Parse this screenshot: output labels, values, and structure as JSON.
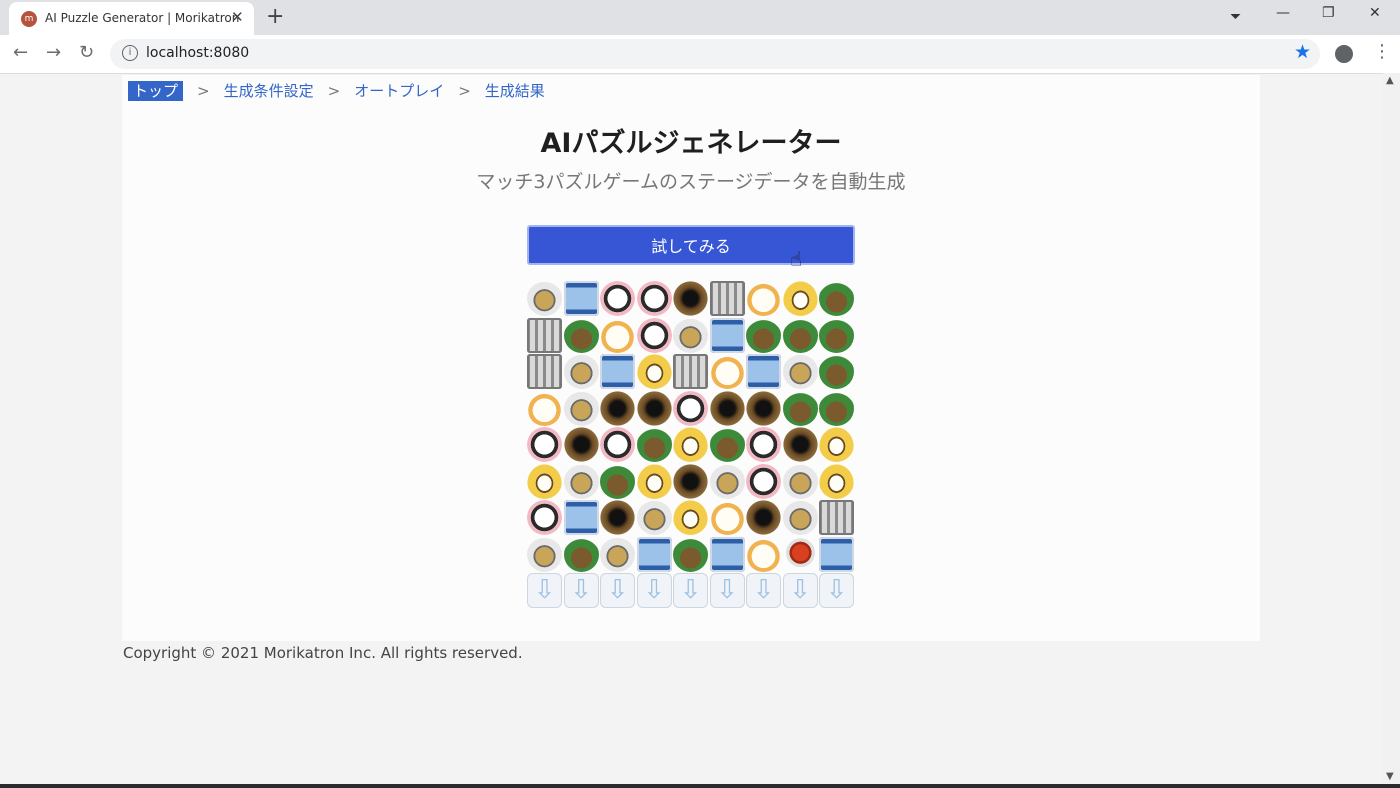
{
  "browser": {
    "tab_title": "AI Puzzle Generator | Morikatron",
    "url": "localhost:8080",
    "icons": [
      "back-arrow-icon",
      "forward-arrow-icon",
      "reload-icon",
      "info-icon",
      "bookmark-star-icon",
      "profile-icon",
      "menu-kebab-icon"
    ]
  },
  "breadcrumb": {
    "items": [
      {
        "label": "トップ",
        "active": true
      },
      {
        "label": "生成条件設定",
        "active": false
      },
      {
        "label": "オートプレイ",
        "active": false
      },
      {
        "label": "生成結果",
        "active": false
      }
    ],
    "separator": ">"
  },
  "header": {
    "title": "AIパズルジェネレーター",
    "subtitle": "マッチ3パズルゲームのステージデータを自動生成"
  },
  "cta": {
    "label": "試してみる"
  },
  "board": {
    "columns": 9,
    "rows": [
      [
        "giraffe",
        "jar",
        "cow",
        "cow",
        "hole",
        "cage",
        "chick",
        "penguin",
        "turtle"
      ],
      [
        "cage",
        "turtle",
        "chick",
        "cow",
        "giraffe",
        "jar",
        "turtle",
        "turtle",
        "turtle"
      ],
      [
        "cage",
        "giraffe",
        "jar",
        "penguin",
        "cage",
        "chick",
        "jar",
        "giraffe",
        "turtle"
      ],
      [
        "chick",
        "giraffe",
        "hole",
        "hole",
        "cow",
        "hole",
        "hole",
        "turtle",
        "turtle"
      ],
      [
        "cow",
        "hole",
        "cow",
        "turtle",
        "penguin",
        "turtle",
        "cow",
        "hole",
        "penguin"
      ],
      [
        "penguin",
        "giraffe",
        "turtle",
        "penguin",
        "hole",
        "giraffe",
        "cow",
        "giraffe",
        "penguin"
      ],
      [
        "cow",
        "jar",
        "hole",
        "giraffe",
        "penguin",
        "chick",
        "hole",
        "giraffe",
        "cage"
      ],
      [
        "giraffe",
        "turtle",
        "giraffe",
        "jar",
        "turtle",
        "jar",
        "chick",
        "crab",
        "jar"
      ],
      [
        "arrow",
        "arrow",
        "arrow",
        "arrow",
        "arrow",
        "arrow",
        "arrow",
        "arrow",
        "arrow"
      ]
    ]
  },
  "footer": {
    "copyright": "Copyright © 2021 Morikatron Inc. All rights reserved."
  },
  "colors": {
    "accent": "#3656d6",
    "link": "#3465c8",
    "bookmark": "#1a73e8"
  }
}
